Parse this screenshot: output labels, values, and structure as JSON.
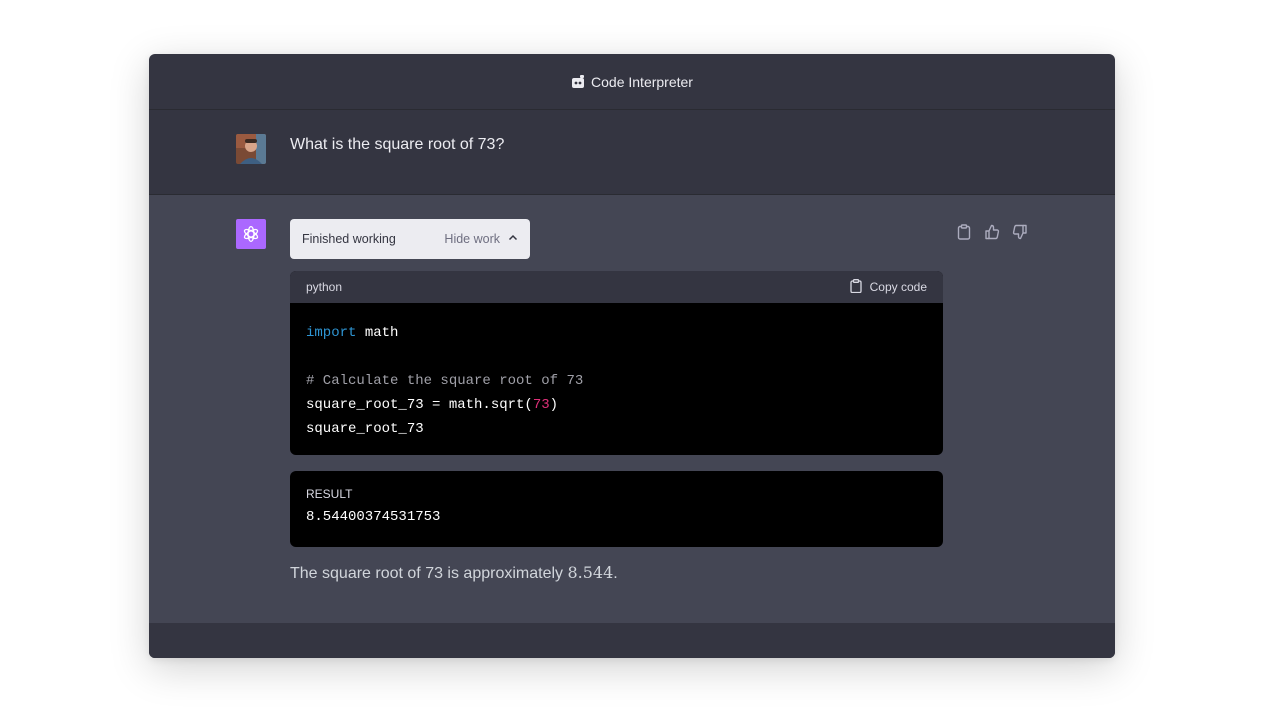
{
  "window": {
    "title": "Code Interpreter",
    "title_icon": "code-interpreter-icon"
  },
  "user_message": {
    "text": "What is the square root of 73?",
    "avatar": "user-avatar"
  },
  "assistant_message": {
    "avatar_icon": "openai-logo-icon",
    "status": {
      "label": "Finished working",
      "toggle_label": "Hide work",
      "toggle_icon": "chevron-up-icon"
    },
    "actions": [
      "clipboard-icon",
      "thumbs-up-icon",
      "thumbs-down-icon"
    ],
    "code": {
      "language": "python",
      "copy_label": "Copy code",
      "lines": [
        [
          {
            "t": "import",
            "c": "kw"
          },
          {
            "t": " math",
            "c": ""
          }
        ],
        [],
        [
          {
            "t": "# Calculate the square root of 73",
            "c": "cm"
          }
        ],
        [
          {
            "t": "square_root_73 = math.sqrt(",
            "c": ""
          },
          {
            "t": "73",
            "c": "num"
          },
          {
            "t": ")",
            "c": ""
          }
        ],
        [
          {
            "t": "square_root_73",
            "c": ""
          }
        ]
      ]
    },
    "result": {
      "label": "RESULT",
      "value": "8.54400374531753"
    },
    "answer": {
      "prefix": "The square root of 73 is approximately ",
      "math": "8.544",
      "suffix": "."
    }
  },
  "colors": {
    "accent_bot": "#ab68ff",
    "code_keyword": "#2e95d3",
    "code_number": "#df3079",
    "code_comment": "#a0a0a8"
  }
}
